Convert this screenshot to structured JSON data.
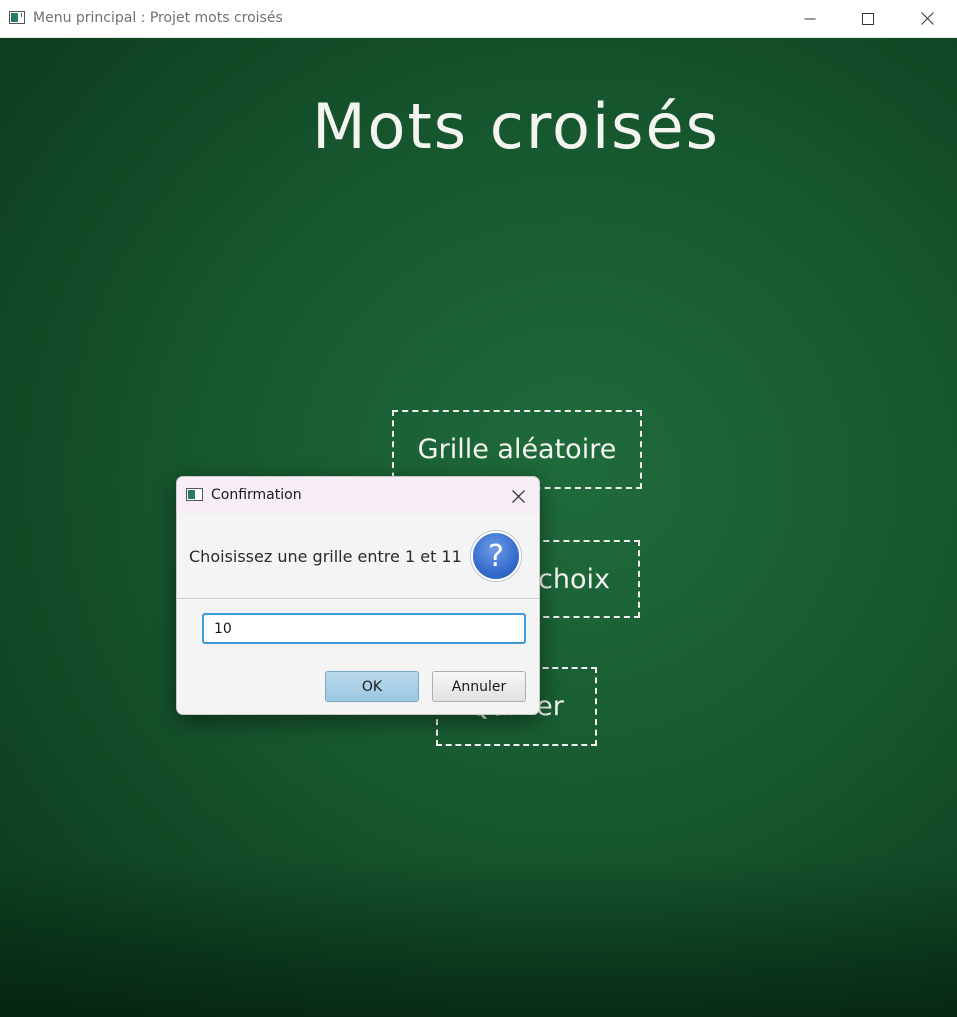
{
  "window": {
    "title": "Menu principal : Projet mots croisés"
  },
  "board": {
    "title": "Mots croisés",
    "buttons": {
      "random": "Grille aléatoire",
      "choice": "choix",
      "quit": "Quitter"
    }
  },
  "dialog": {
    "title": "Confirmation",
    "message": "Choisissez une grille entre 1 et 11",
    "icon": "?",
    "input_value": "10",
    "ok_label": "OK",
    "cancel_label": "Annuler"
  },
  "colors": {
    "board_green": "#17582f",
    "chalk": "#f4f4f0",
    "input_focus": "#3f9ad8",
    "ok_button": "#9cc8e2",
    "question_icon": "#3a6fd0"
  },
  "icons": {
    "app": "app-window-icon",
    "minimize": "minimize-icon",
    "maximize": "maximize-icon",
    "close": "close-icon",
    "question": "question-icon"
  }
}
